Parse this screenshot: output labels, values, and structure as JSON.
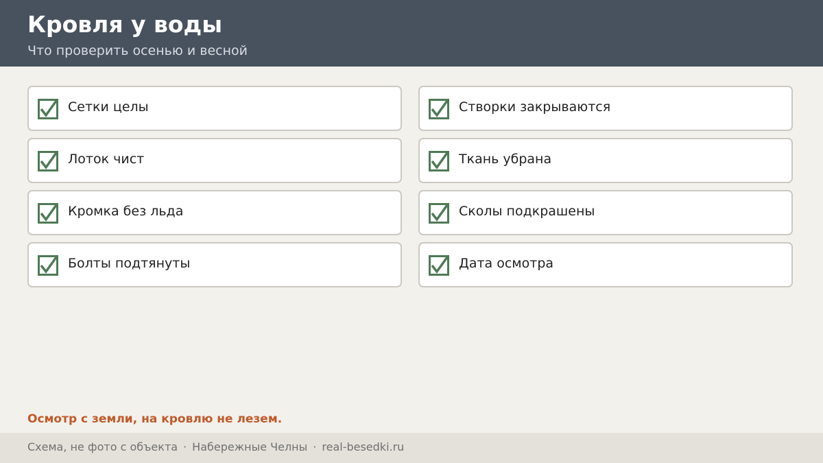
{
  "header": {
    "title": "Кровля у воды",
    "subtitle": "Что проверить осенью и весной"
  },
  "checklist": [
    {
      "label": "Сетки целы",
      "checked": true
    },
    {
      "label": "Створки закрываются",
      "checked": true
    },
    {
      "label": "Лоток чист",
      "checked": true
    },
    {
      "label": "Ткань убрана",
      "checked": true
    },
    {
      "label": "Кромка без льда",
      "checked": true
    },
    {
      "label": "Сколы подкрашены",
      "checked": true
    },
    {
      "label": "Болты подтянуты",
      "checked": true
    },
    {
      "label": "Дата осмотра",
      "checked": true
    }
  ],
  "warning": "Осмотр с земли, на кровлю не лезем.",
  "footer": {
    "note": "Схема, не фото с объекта",
    "separator": "·",
    "city": "Набережные Челны",
    "site": "real-besedki.ru"
  },
  "colors": {
    "header_bg": "#48525e",
    "check": "#4f7a56",
    "warning": "#c05a2a"
  },
  "icons": {
    "check": "checkbox-checked-icon"
  }
}
